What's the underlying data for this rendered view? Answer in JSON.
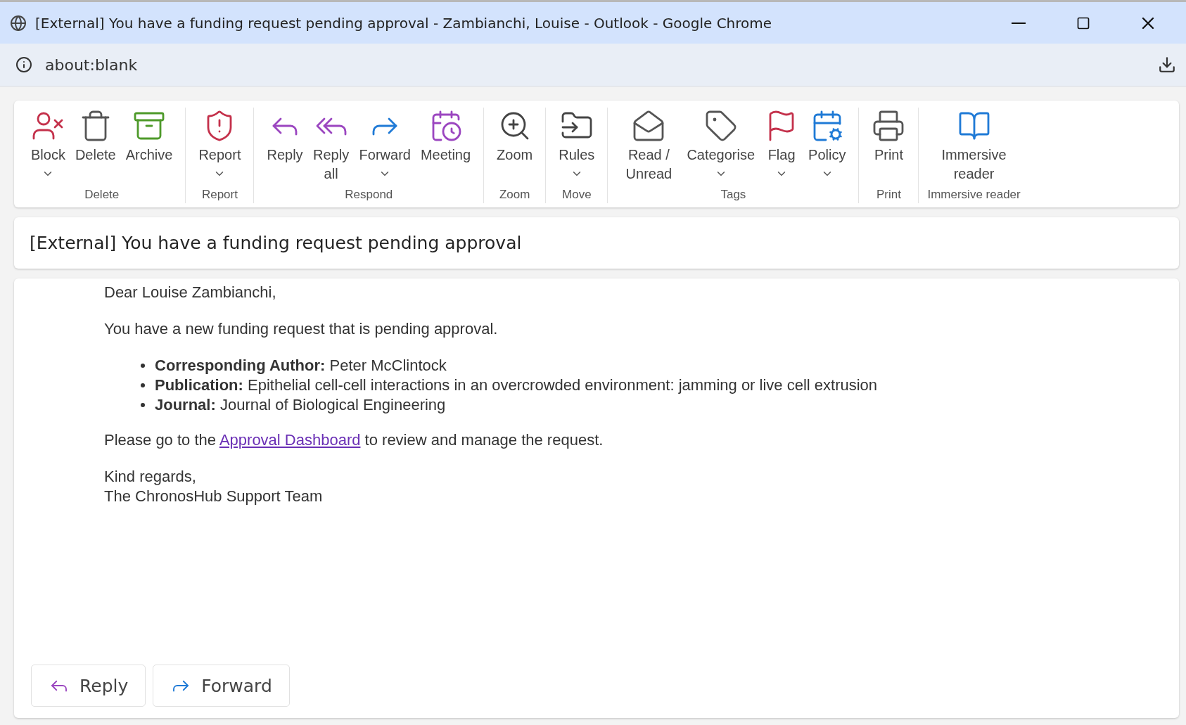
{
  "window": {
    "title": "[External] You have a funding request pending approval - Zambianchi, Louise - Outlook - Google Chrome"
  },
  "address_bar": {
    "url": "about:blank"
  },
  "ribbon": {
    "groups": [
      {
        "label": "Delete",
        "commands": [
          {
            "kind": "block",
            "label": "Block",
            "dropdown": true
          },
          {
            "kind": "delete",
            "label": "Delete",
            "dropdown": false
          },
          {
            "kind": "archive",
            "label": "Archive",
            "dropdown": false
          }
        ]
      },
      {
        "label": "Report",
        "commands": [
          {
            "kind": "report",
            "label": "Report",
            "dropdown": true
          }
        ]
      },
      {
        "label": "Respond",
        "commands": [
          {
            "kind": "reply",
            "label": "Reply",
            "dropdown": false
          },
          {
            "kind": "reply_all",
            "label": "Reply all",
            "dropdown": false
          },
          {
            "kind": "forward",
            "label": "Forward",
            "dropdown": true
          },
          {
            "kind": "meeting",
            "label": "Meeting",
            "dropdown": false
          }
        ]
      },
      {
        "label": "Zoom",
        "commands": [
          {
            "kind": "zoom",
            "label": "Zoom",
            "dropdown": false
          }
        ]
      },
      {
        "label": "Move",
        "commands": [
          {
            "kind": "rules",
            "label": "Rules",
            "dropdown": true
          }
        ]
      },
      {
        "label": "Tags",
        "commands": [
          {
            "kind": "read_unread",
            "label": "Read / Unread",
            "dropdown": false
          },
          {
            "kind": "categorise",
            "label": "Categorise",
            "dropdown": true
          },
          {
            "kind": "flag",
            "label": "Flag",
            "dropdown": true
          },
          {
            "kind": "policy",
            "label": "Policy",
            "dropdown": true
          }
        ]
      },
      {
        "label": "Print",
        "commands": [
          {
            "kind": "print",
            "label": "Print",
            "dropdown": false
          }
        ]
      },
      {
        "label": "Immersive reader",
        "commands": [
          {
            "kind": "immersive",
            "label": "Immersive reader",
            "dropdown": false
          }
        ]
      }
    ]
  },
  "message": {
    "subject": "[External] You have a funding request pending approval",
    "greeting": "Dear Louise Zambianchi,",
    "intro": "You have a new funding request that is pending approval.",
    "details": [
      "**Corresponding Author:** Peter McClintock",
      "**Publication:** Epithelial cell-cell interactions in an overcrowded environment: jamming or live cell extrusion",
      "**Journal:** Journal of Biological Engineering"
    ],
    "action": {
      "before": "Please go to the ",
      "link": "Approval Dashboard",
      "after": " to review and manage the request."
    },
    "closing": "Kind regards,",
    "signature": "The ChronosHub Support Team"
  },
  "actions": [
    {
      "kind": "reply",
      "label": "Reply"
    },
    {
      "kind": "forward",
      "label": "Forward"
    }
  ]
}
